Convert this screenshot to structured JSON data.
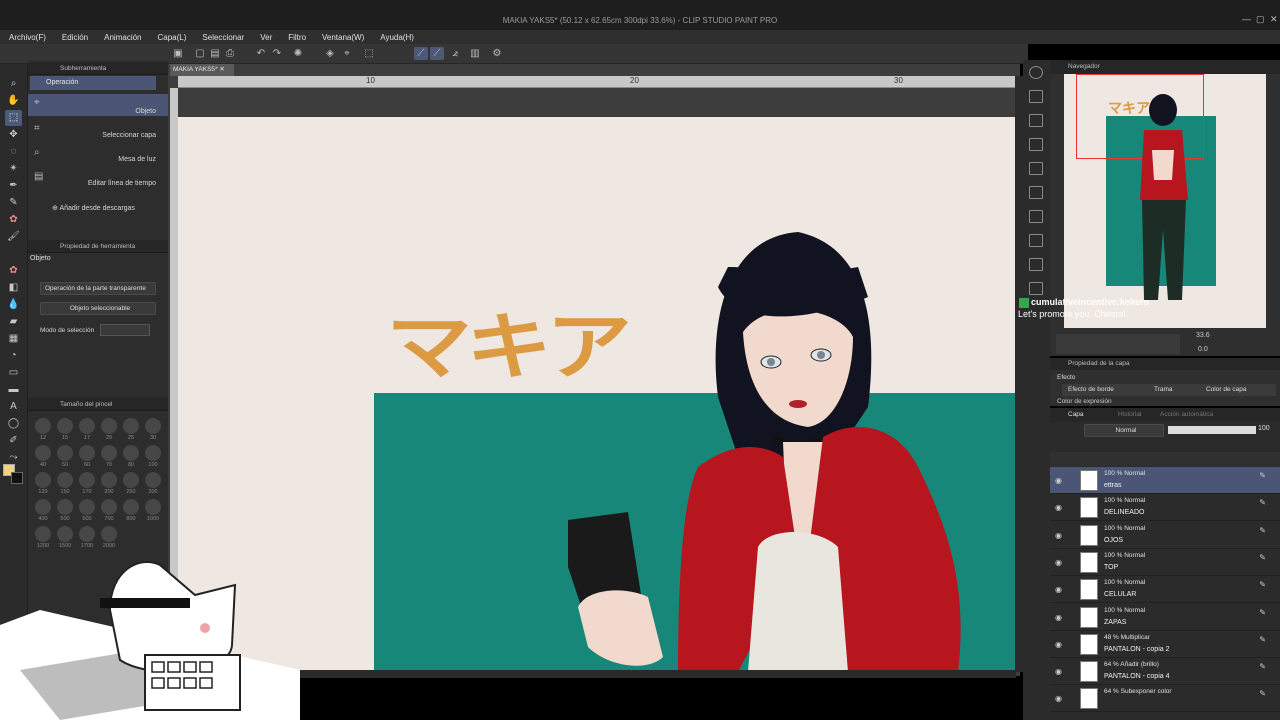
{
  "window": {
    "title": "MAKIA YAKS5* (50.12 x 62.65cm 300dpi 33.6%) - CLIP STUDIO PAINT PRO"
  },
  "menu": [
    "Archivo(F)",
    "Edición",
    "Animación",
    "Capa(L)",
    "Seleccionar",
    "Ver",
    "Filtro",
    "Ventana(W)",
    "Ayuda(H)"
  ],
  "subtool": {
    "header": "Subherramienta",
    "group": "Operación",
    "items": [
      "Objeto",
      "Seleccionar capa",
      "Mesa de luz",
      "Editar línea de tiempo"
    ],
    "add_label": "Añadir desde descargas"
  },
  "tool_property": {
    "header": "Propiedad de herramienta",
    "title": "Objeto",
    "transparent_op": "Operación de la parte transparente",
    "selected_obj": "Objeto seleccionable",
    "selection_mode_label": "Modo de selección"
  },
  "brush_size": {
    "header": "Tamaño del pincel",
    "sizes": [
      "12",
      "15",
      "17",
      "20",
      "25",
      "30",
      "40",
      "50",
      "60",
      "70",
      "80",
      "100",
      "120",
      "150",
      "170",
      "200",
      "250",
      "300",
      "400",
      "500",
      "600",
      "700",
      "800",
      "1000",
      "1200",
      "1500",
      "1700",
      "2000"
    ]
  },
  "canvas": {
    "tab": "MAKIA YAKS5*",
    "ruler_marks": [
      "10",
      "20",
      "30"
    ],
    "katakana": "マキア",
    "canvas_bg": "#efe8e2",
    "teal": "#17877a",
    "orange": "#dc9a43"
  },
  "navigator": {
    "header": "Navegador",
    "thumb_text": "マキア",
    "zoom": "33.6",
    "rotation": "0.0"
  },
  "overlay": {
    "line1": "cumulativeincentive:kekero",
    "line2": "Let's promote you. Cheers!"
  },
  "layer_property": {
    "header": "Propiedad de la capa",
    "effect_label": "Efecto",
    "buttons": [
      "Efecto de borde",
      "Trama",
      "Color de capa"
    ],
    "color_expr": "Color de expresión"
  },
  "layers_panel": {
    "tabs": [
      "Capa",
      "Historial",
      "Acción automática"
    ],
    "blend": "Normal",
    "opacity": "100",
    "layers": [
      {
        "mode": "100 % Normal",
        "name": "ettras",
        "selected": true
      },
      {
        "mode": "100 % Normal",
        "name": "DELINEADO",
        "selected": false
      },
      {
        "mode": "100 % Normal",
        "name": "OJOS",
        "selected": false
      },
      {
        "mode": "100 % Normal",
        "name": "TOP",
        "selected": false
      },
      {
        "mode": "100 % Normal",
        "name": "CELULAR",
        "selected": false
      },
      {
        "mode": "100 % Normal",
        "name": "ZAPAS",
        "selected": false
      },
      {
        "mode": "48 % Multiplicar",
        "name": "PANTALON - copia 2",
        "selected": false
      },
      {
        "mode": "64 % Añadir (brillo)",
        "name": "PANTALON - copia 4",
        "selected": false
      },
      {
        "mode": "64 % Subexponer color",
        "name": "",
        "selected": false
      }
    ]
  }
}
